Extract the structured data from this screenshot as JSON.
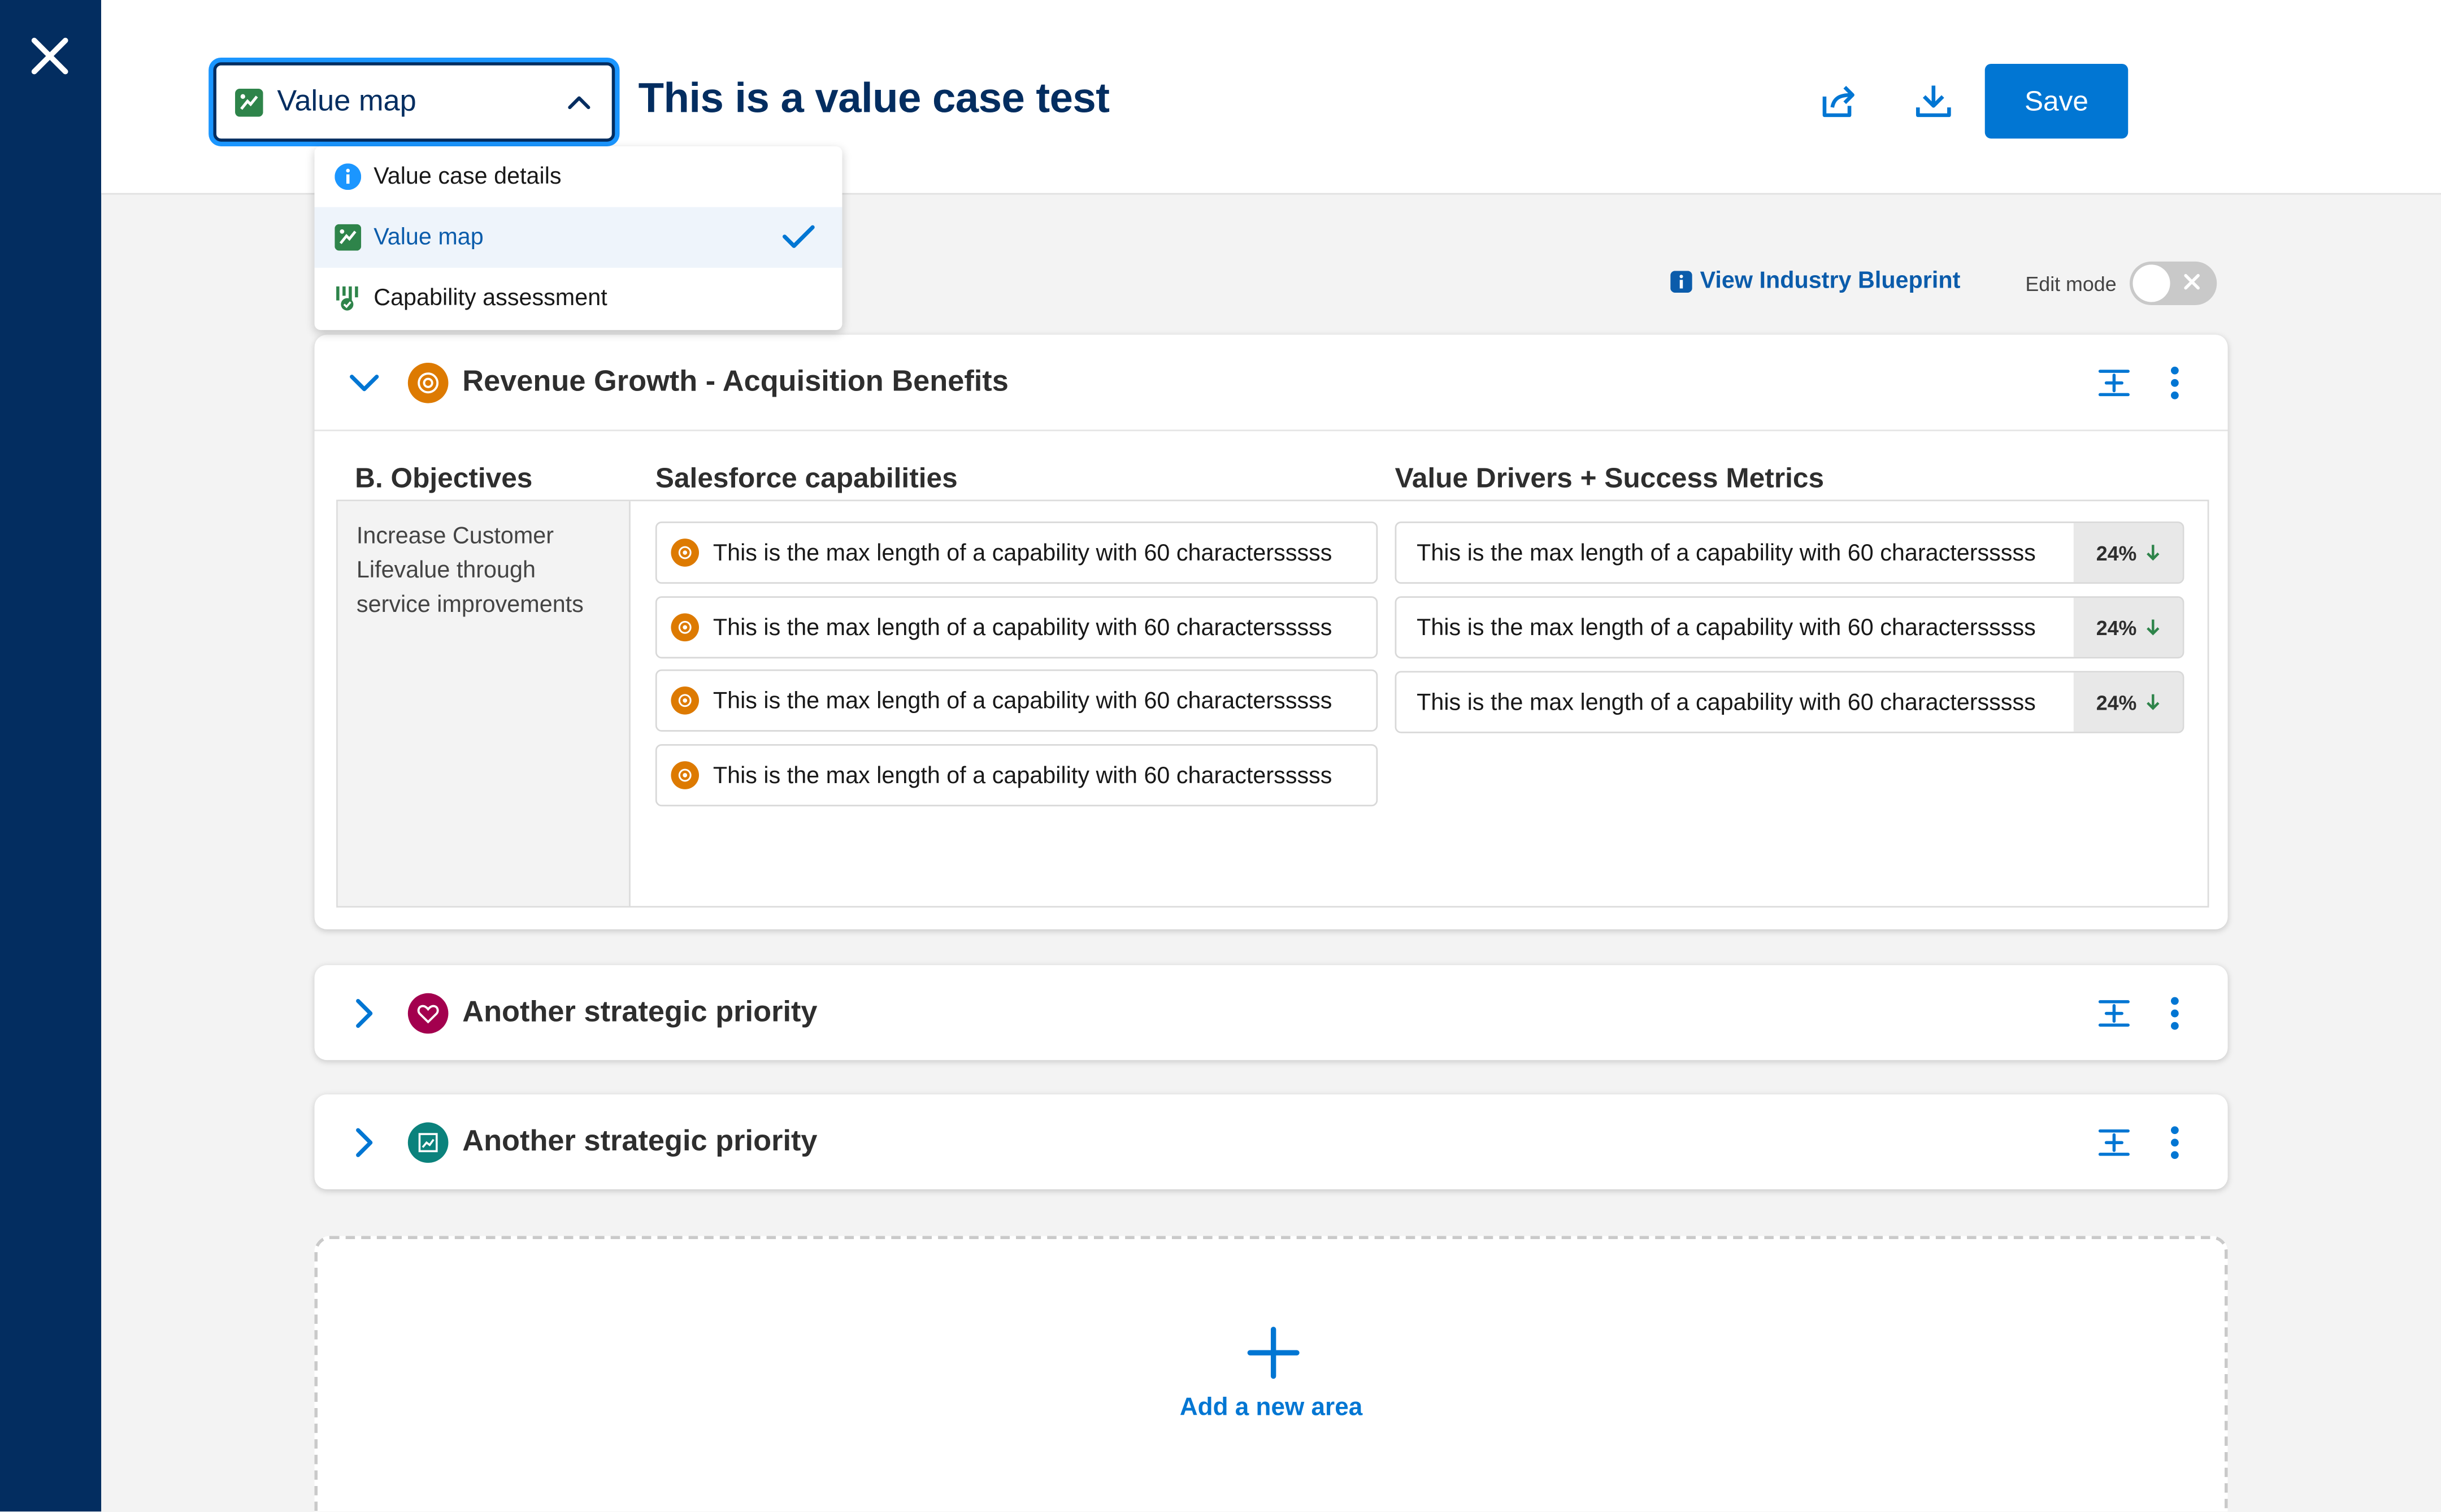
{
  "colors": {
    "rail": "#032d60",
    "brand": "#0176d3",
    "title": "#032d60",
    "orange": "#dd7a01",
    "crimson": "#a3004e",
    "teal": "#0b827c",
    "green": "#2e844a"
  },
  "close_icon": "close-icon",
  "view_selector": {
    "label": "Value map"
  },
  "page_title": "This is a value case test",
  "header_actions": {
    "share": "share-icon",
    "download": "download-icon",
    "more": "more-icon"
  },
  "save_label": "Save",
  "dropdown": {
    "items": [
      {
        "label": "Value case details",
        "icon": "info-icon"
      },
      {
        "label": "Value map",
        "icon": "value-map-icon",
        "selected": true
      },
      {
        "label": "Capability assessment",
        "icon": "capability-assessment-icon"
      }
    ]
  },
  "blueprint_link": "View Industry Blueprint",
  "edit_mode": {
    "label": "Edit mode",
    "on": false
  },
  "priorities": [
    {
      "title": "Revenue Growth - Acquisition Benefits",
      "expanded": true,
      "icon": "revenue-icon",
      "columns": {
        "objectives": "B. Objectives",
        "capabilities": "Salesforce capabilities",
        "drivers": "Value Drivers + Success Metrics"
      },
      "objective": "Increase Customer Lifevalue through service improvements",
      "capabilities": [
        "This is the max length of a capability with 60 charactersssss",
        "This is the max length of a capability with 60 charactersssss",
        "This is the max length of a capability with 60 charactersssss",
        "This is the max length of a capability with 60 charactersssss"
      ],
      "drivers": [
        {
          "text": "This is the max length of a capability with 60 charactersssss",
          "metric": "24%",
          "trend": "down"
        },
        {
          "text": "This is the max length of a capability with 60 charactersssss",
          "metric": "24%",
          "trend": "down"
        },
        {
          "text": "This is the max length of a capability with 60 charactersssss",
          "metric": "24%",
          "trend": "down"
        }
      ]
    },
    {
      "title": "Another strategic priority",
      "expanded": false,
      "icon": "heart-icon"
    },
    {
      "title": "Another strategic priority",
      "expanded": false,
      "icon": "chart-icon"
    }
  ],
  "add_area_label": "Add a new area"
}
